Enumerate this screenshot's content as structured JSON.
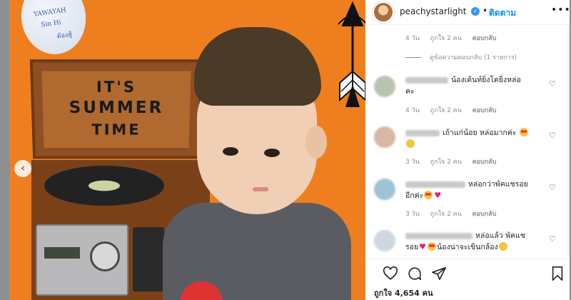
{
  "post": {
    "username": "peachystarlight",
    "follow_label": "ติดตาม",
    "separator": "•",
    "more_label": "•••",
    "likes_text": "ถูกใจ 4,654 คน"
  },
  "photo": {
    "lid_text_lines": [
      "IT'S",
      "SUMMER",
      "TIME"
    ],
    "sticker_doodles": [
      "YAWAYAH",
      "Sin Hi",
      "ต้องสู้"
    ]
  },
  "comments_top_meta": {
    "time": "4 วัน",
    "likes": "ถูกใจ 2 คน",
    "reply": "ตอบกลับ"
  },
  "view_replies_label": "ดูข้อความตอบกลับ (1 รายการ)",
  "comments": [
    {
      "text_line1": "น้องเต้นท์ยิ่งโตยิ่งหล่อ",
      "text_line2": "คะ",
      "time": "4 วัน",
      "likes": "ถูกใจ 2 คน",
      "reply": "ตอบกลับ",
      "emoji": []
    },
    {
      "text_line1": "เถ้าแก่น้อย หล่อมากค่ะ",
      "text_line2": "",
      "time": "3 วัน",
      "likes": "ถูกใจ 2 คน",
      "reply": "ตอบกลับ",
      "emoji": [
        "love",
        "grin"
      ]
    },
    {
      "text_line1": "หล่อกว่าพัคแชรอย",
      "text_line2": "อีกค่ะ",
      "time": "3 วัน",
      "likes": "ถูกใจ 2 คน",
      "reply": "ตอบกลับ",
      "emoji": [
        "love",
        "heart"
      ]
    },
    {
      "text_line1": "หล่อแล้ว พัคแช",
      "text_line2": "รอย",
      "text_line2_tail": "น้องน่าจะเขินกล้อง",
      "time": "",
      "likes": "",
      "reply": "",
      "emoji": [
        "heart",
        "love",
        "grin"
      ]
    }
  ],
  "colors": {
    "accent": "#0095f6",
    "verified": "#3897f0",
    "photo_bg": "#ef7f1e",
    "heart_emoji": "#e0245e"
  },
  "icons": {
    "like": "heart-icon",
    "comment": "comment-icon",
    "share": "share-icon",
    "save": "bookmark-icon",
    "prev": "chevron-left-icon",
    "more": "more-icon"
  }
}
